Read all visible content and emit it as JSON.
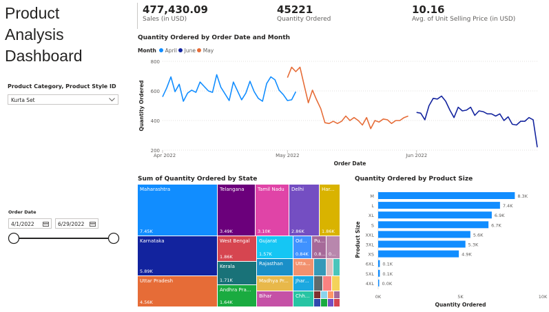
{
  "dashboard": {
    "title_lines": [
      "Product",
      "Analysis",
      "Dashboard"
    ]
  },
  "kpis": [
    {
      "value": "477,430.09",
      "label": "Sales (in USD)"
    },
    {
      "value": "45221",
      "label": "Quantity Ordered"
    },
    {
      "value": "10.16",
      "label": "Avg. of Unit Selling Price (in USD)"
    }
  ],
  "category_slicer": {
    "label": "Product Category, Product Style ID",
    "selected": "Kurta Set"
  },
  "date_slicer": {
    "label": "Order Date",
    "start": "4/1/2022",
    "end": "6/29/2022"
  },
  "colors": {
    "april": "#118DFF",
    "june": "#12239E",
    "may": "#E66C37",
    "bar": "#118DFF"
  },
  "icons": [
    "chevron-down-icon",
    "calendar-icon"
  ],
  "chart_data": [
    {
      "type": "line",
      "title": "Quantity Ordered by Order Date and Month",
      "legend_title": "Month",
      "xlabel": "Order Date",
      "ylabel": "Quantity Ordered",
      "ylim": [
        200,
        800
      ],
      "y_ticks": [
        "800",
        "600",
        "400",
        "200"
      ],
      "x_ticks": [
        "Apr 2022",
        "May 2022",
        "Jun 2022"
      ],
      "legend_position": "top-left",
      "series": [
        {
          "name": "April",
          "start": "2022-04-01",
          "values": [
            560,
            620,
            695,
            595,
            645,
            530,
            585,
            605,
            590,
            660,
            630,
            600,
            590,
            710,
            625,
            580,
            535,
            660,
            600,
            540,
            585,
            665,
            595,
            550,
            530,
            650,
            695,
            675,
            605,
            575,
            535,
            540,
            595
          ]
        },
        {
          "name": "May",
          "start": "2022-05-01",
          "values": [
            690,
            760,
            730,
            760,
            640,
            520,
            605,
            540,
            480,
            385,
            380,
            395,
            380,
            395,
            430,
            400,
            420,
            400,
            370,
            420,
            345,
            400,
            390,
            410,
            405,
            380,
            400,
            400,
            420,
            430
          ]
        },
        {
          "name": "June",
          "start": "2022-06-01",
          "values": [
            455,
            450,
            405,
            500,
            550,
            545,
            565,
            530,
            470,
            420,
            490,
            465,
            470,
            490,
            435,
            465,
            460,
            445,
            445,
            430,
            445,
            400,
            425,
            375,
            370,
            395,
            395,
            420,
            405,
            220
          ]
        }
      ]
    },
    {
      "type": "heatmap",
      "title": "Sum of Quantity Ordered by State",
      "cells": [
        {
          "label": "Maharashtra",
          "value": "7.45K",
          "color": "#118DFF"
        },
        {
          "label": "Karnataka",
          "value": "5.89K",
          "color": "#12239E"
        },
        {
          "label": "Uttar Pradesh",
          "value": "4.56K",
          "color": "#E66C37"
        },
        {
          "label": "Telangana",
          "value": "3.49K",
          "color": "#6B007B"
        },
        {
          "label": "Tamil Nadu",
          "value": "3.10K",
          "color": "#E044A7"
        },
        {
          "label": "Delhi",
          "value": "2.86K",
          "color": "#744EC2"
        },
        {
          "label": "Har...",
          "value": "1.86K",
          "color": "#D9B300"
        },
        {
          "label": "West Bengal",
          "value": "1.86K",
          "color": "#D64550"
        },
        {
          "label": "Kerala",
          "value": "1.71K",
          "color": "#197278"
        },
        {
          "label": "Andhra Pra...",
          "value": "1.64K",
          "color": "#1AAB40"
        },
        {
          "label": "Gujarat",
          "value": "1.57K",
          "color": "#15C6F4"
        },
        {
          "label": "Od...",
          "value": "0.84K",
          "color": "#4092FF"
        },
        {
          "label": "Pu...",
          "value": "0.8...",
          "color": "#A66999"
        },
        {
          "label": "",
          "value": "0...",
          "color": "#B887AD"
        },
        {
          "label": "Rajasthan",
          "value": "",
          "color": "#1A8FC8"
        },
        {
          "label": "Madhya Pr...",
          "value": "",
          "color": "#E8B84A"
        },
        {
          "label": "Utta...",
          "value": "",
          "color": "#F2916E"
        },
        {
          "label": "Bihar",
          "value": "",
          "color": "#C551A6"
        },
        {
          "label": "Jhar...",
          "value": "",
          "color": "#1BA8E0"
        },
        {
          "label": "Chh...",
          "value": "",
          "color": "#27C4A3"
        }
      ]
    },
    {
      "type": "bar",
      "orientation": "horizontal",
      "title": "Quantity Ordered by Product Size",
      "xlabel": "Quantity Ordered",
      "ylabel": "Product Size",
      "xlim": [
        0,
        10000
      ],
      "x_ticks": [
        "0K",
        "5K",
        "10K"
      ],
      "categories": [
        "M",
        "L",
        "XL",
        "S",
        "XXL",
        "3XL",
        "XS",
        "6XL",
        "5XL",
        "4XL"
      ],
      "values": [
        8300,
        7400,
        6900,
        6700,
        5600,
        5300,
        4900,
        100,
        100,
        0
      ],
      "data_labels": [
        "8.3K",
        "7.4K",
        "6.9K",
        "6.7K",
        "5.6K",
        "5.3K",
        "4.9K",
        "0.1K",
        "0.1K",
        "0.0K"
      ]
    }
  ]
}
